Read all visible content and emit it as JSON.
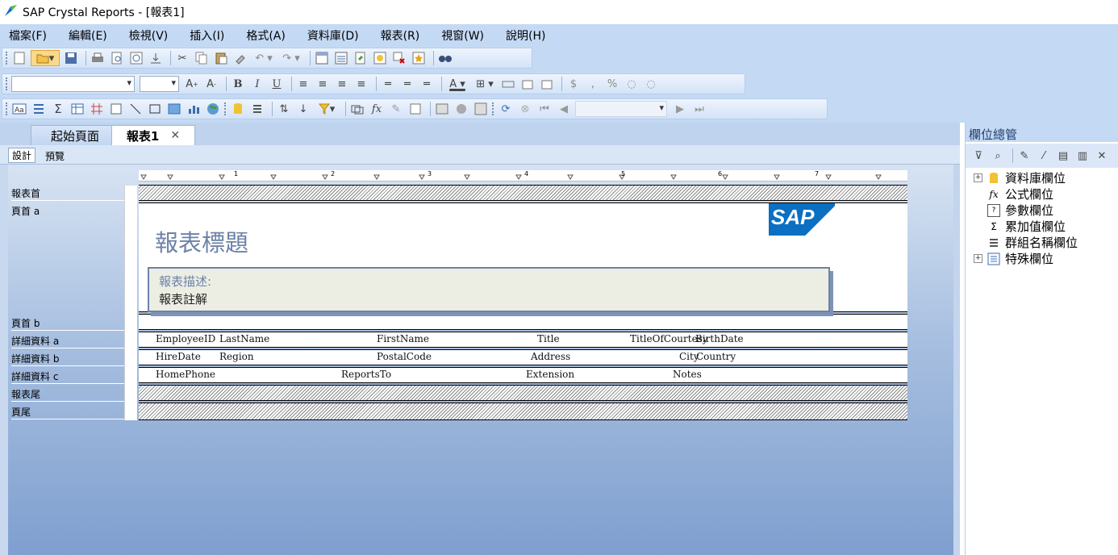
{
  "window": {
    "title": "SAP Crystal Reports - [報表1]"
  },
  "menu": [
    "檔案(F)",
    "編輯(E)",
    "檢視(V)",
    "插入(I)",
    "格式(A)",
    "資料庫(D)",
    "報表(R)",
    "視窗(W)",
    "說明(H)"
  ],
  "toolbar": {
    "format_glyphs": {
      "bold": "B",
      "italic": "I",
      "underline": "U",
      "font_color": "A",
      "currency": "$",
      "comma": ",",
      "percent": "%"
    },
    "expert_glyphs": {
      "sum": "Σ",
      "formula": "fx"
    }
  },
  "tabs": {
    "home": "起始頁面",
    "report": "報表1",
    "close": "✕"
  },
  "view_tabs": {
    "design": "設計",
    "preview": "預覽"
  },
  "ruler": {
    "marks": [
      "1",
      "2",
      "3",
      "4",
      "5",
      "6",
      "7"
    ]
  },
  "sections": {
    "report_header": "報表首",
    "page_header_a": "頁首 a",
    "page_header_b": "頁首 b",
    "details_a": "詳細資料 a",
    "details_b": "詳細資料 b",
    "details_c": "詳細資料 c",
    "report_footer": "報表尾",
    "page_footer": "頁尾"
  },
  "report": {
    "title": "報表標題",
    "desc_label": "報表描述:",
    "comments": "報表註解",
    "logo": "SAP"
  },
  "fields": {
    "row_a": [
      "EmployeeID",
      "LastName",
      "FirstName",
      "Title",
      "TitleOfCourtesy",
      "BirthDate"
    ],
    "row_b": [
      "HireDate",
      "Region",
      "PostalCode",
      "Address",
      "City",
      "Country"
    ],
    "row_c": [
      "HomePhone",
      "ReportsTo",
      "Extension",
      "Notes"
    ]
  },
  "field_explorer": {
    "title": "欄位總管",
    "items": [
      "資料庫欄位",
      "公式欄位",
      "參數欄位",
      "累加值欄位",
      "群組名稱欄位",
      "特殊欄位"
    ]
  },
  "colors": {
    "accent": "#c4d9f4",
    "title_text": "#6d82a8",
    "desc_bg": "#eceee4"
  }
}
